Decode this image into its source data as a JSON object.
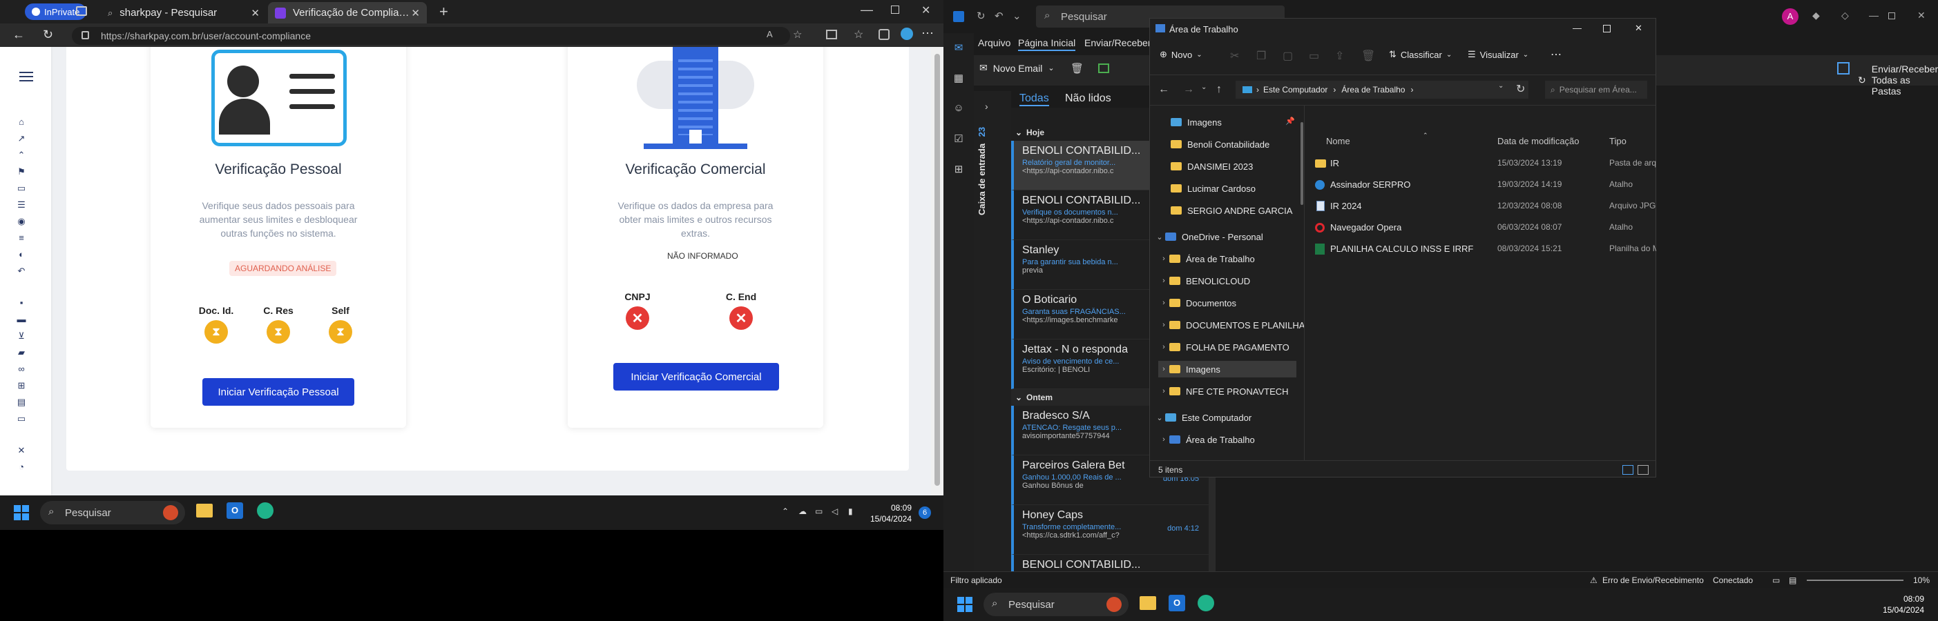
{
  "edge": {
    "badge": "InPrivate",
    "tabs": [
      {
        "label": "sharkpay - Pesquisar"
      },
      {
        "label": "Verificação de Compliance | Shar..."
      }
    ],
    "url": "https://sharkpay.com.br/user/account-compliance"
  },
  "personal": {
    "title": "Verificação Pessoal",
    "description": "Verifique seus dados pessoais para aumentar seus limites e desbloquear outras funções no sistema.",
    "status": "AGUARDANDO ANÁLISE",
    "docs": [
      {
        "label": "Doc. Id."
      },
      {
        "label": "C. Res"
      },
      {
        "label": "Self"
      }
    ],
    "button": "Iniciar Verificação Pessoal"
  },
  "business": {
    "title": "Verificação Comercial",
    "description": "Verifique os dados da empresa para obter mais limites e outros recursos extras.",
    "status": "NÃO INFORMADO",
    "docs": [
      {
        "label": "CNPJ"
      },
      {
        "label": "C. End"
      }
    ],
    "button": "Iniciar Verificação Comercial"
  },
  "taskbar_left": {
    "search": "Pesquisar",
    "time": "08:09",
    "date": "15/04/2024",
    "badge": "6"
  },
  "outlook": {
    "search": "Pesquisar",
    "avatar": "A",
    "ribbon_tabs": [
      "Arquivo",
      "Página Inicial",
      "Enviar/Receber"
    ],
    "new_email": "Novo Email",
    "send_receive_all": "Enviar/Receber Todas as Pastas",
    "folder_label": "Caixa de entrada",
    "folder_count": "23",
    "filters": [
      "Todas",
      "Não lidos"
    ],
    "groups": [
      "Hoje",
      "Ontem"
    ],
    "mails": [
      {
        "from": "BENOLI CONTABILID...",
        "subject": "Relatório geral de monitor...",
        "preview": "<https://api-contador.nibo.c",
        "time": ""
      },
      {
        "from": "BENOLI CONTABILID...",
        "subject": "Verifique os documentos n...",
        "preview": "<https://api-contador.nibo.c",
        "time": ""
      },
      {
        "from": "Stanley",
        "subject": "Para garantir sua bebida n...",
        "preview": "previa",
        "time": ""
      },
      {
        "from": "O Boticario",
        "subject": "Garanta suas FRAGÂNCIAS...",
        "preview": "<https://images.benchmarke",
        "time": ""
      },
      {
        "from": "Jettax - N  o responda",
        "subject": "Aviso de vencimento de ce...",
        "preview": "Escritório: | BENOLI",
        "time": ""
      },
      {
        "from": "Bradesco S/A",
        "subject": "ATENCAO: Resgate seus p...",
        "preview": "avisoimportante57757944",
        "time": ""
      },
      {
        "from": "Parceiros Galera Bet",
        "subject": "Ganhou 1.000,00 Reais de ...",
        "preview": "Ganhou Bônus de",
        "time": "dom 16:05"
      },
      {
        "from": "Honey Caps",
        "subject": "Transforme completamente...",
        "preview": "<https://ca.sdtrk1.com/aff_c?",
        "time": "dom 4:12"
      },
      {
        "from": "BENOLI CONTABILID...",
        "subject": "",
        "preview": "",
        "time": ""
      }
    ],
    "status_left": "Filtro aplicado",
    "status_error": "Erro de Envio/Recebimento",
    "status_conn": "Conectado",
    "zoom": "10%"
  },
  "explorer": {
    "title": "Área de Trabalho",
    "cmd": {
      "new": "Novo",
      "sort": "Classificar",
      "view": "Visualizar"
    },
    "breadcrumb": [
      "Este Computador",
      "Área de Trabalho"
    ],
    "search_placeholder": "Pesquisar em Área...",
    "tree": [
      {
        "label": "Imagens"
      },
      {
        "label": "Benoli Contabilidade"
      },
      {
        "label": "DANSIMEI 2023"
      },
      {
        "label": "Lucimar Cardoso"
      },
      {
        "label": "SERGIO ANDRE GARCIA"
      },
      {
        "label": "OneDrive - Personal"
      },
      {
        "label": "Área de Trabalho"
      },
      {
        "label": "BENOLICLOUD"
      },
      {
        "label": "Documentos"
      },
      {
        "label": "DOCUMENTOS E PLANILHAS"
      },
      {
        "label": "FOLHA DE PAGAMENTO"
      },
      {
        "label": "Imagens"
      },
      {
        "label": "NFE CTE PRONAVTECH"
      },
      {
        "label": "Este Computador"
      },
      {
        "label": "Área de Trabalho"
      }
    ],
    "columns": [
      "Nome",
      "Data de modificação",
      "Tipo"
    ],
    "files": [
      {
        "name": "IR",
        "date": "15/03/2024 13:19",
        "type": "Pasta de arqu"
      },
      {
        "name": "Assinador SERPRO",
        "date": "19/03/2024 14:19",
        "type": "Atalho"
      },
      {
        "name": "IR 2024",
        "date": "12/03/2024 08:08",
        "type": "Arquivo JPG"
      },
      {
        "name": "Navegador Opera",
        "date": "06/03/2024 08:07",
        "type": "Atalho"
      },
      {
        "name": "PLANILHA CALCULO INSS E IRRF",
        "date": "08/03/2024 15:21",
        "type": "Planilha do M"
      }
    ],
    "status": "5 itens"
  },
  "taskbar_right": {
    "search": "Pesquisar",
    "time": "08:09",
    "date": "15/04/2024"
  }
}
